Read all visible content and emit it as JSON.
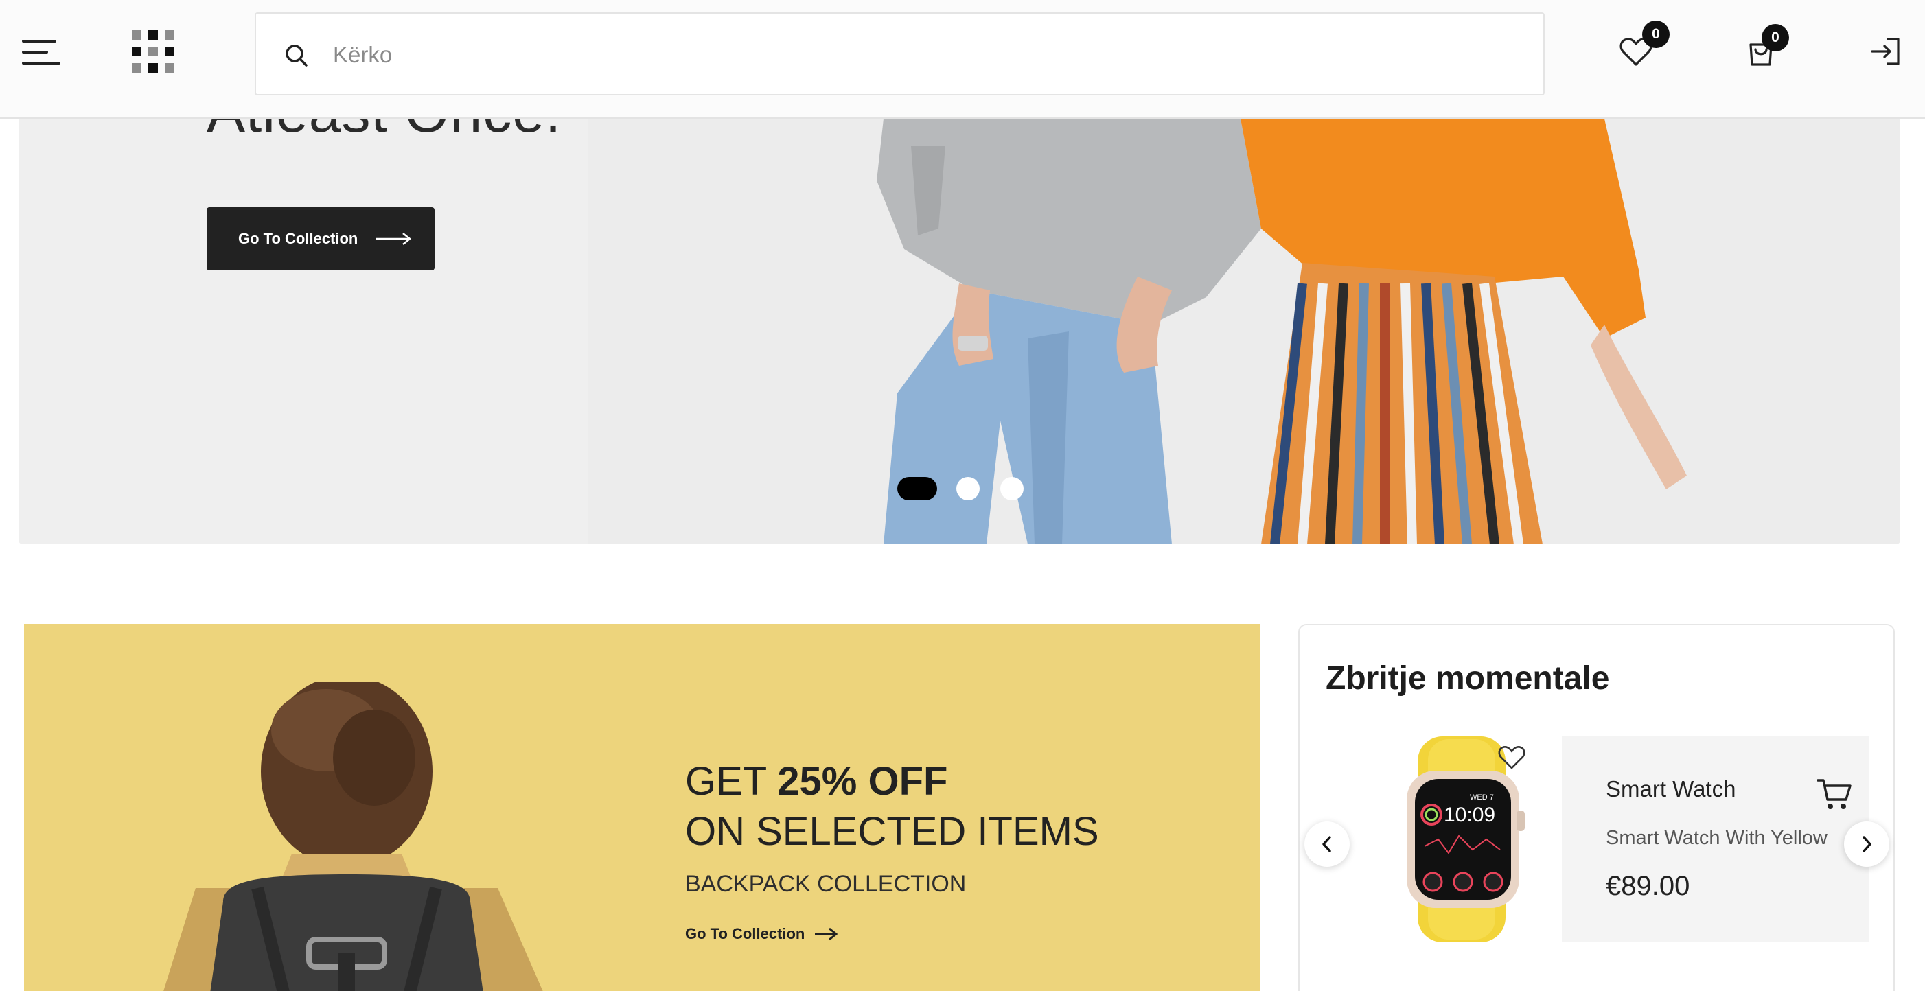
{
  "header": {
    "search": {
      "placeholder": "Kërko",
      "value": ""
    },
    "wishlist": {
      "count": "0"
    },
    "cart": {
      "count": "0"
    },
    "icons": {
      "menu": "hamburger-menu-icon",
      "logo": "grid-logo-icon",
      "search": "search-icon",
      "wishlist": "heart-icon",
      "cart": "shopping-bag-icon",
      "login": "login-icon"
    }
  },
  "hero": {
    "title": "Atleast Once.",
    "button_label": "Go To Collection",
    "slides": {
      "count": 3,
      "active_index": 0
    }
  },
  "promo": {
    "line1_prefix": "GET ",
    "line1_bold": "25% OFF",
    "line2": "ON SELECTED ITEMS",
    "line3": "BACKPACK COLLECTION",
    "link_label": "Go To Collection"
  },
  "deals": {
    "title": "Zbritje momentale",
    "product": {
      "name": "Smart Watch",
      "description": "Smart Watch With Yellow",
      "price": "€89.00",
      "watch_day": "WED 7",
      "watch_time": "10:09"
    }
  },
  "colors": {
    "accent_dark": "#222222",
    "promo_bg": "#edd47c",
    "hero_bg": "#efefef",
    "badge": "#111111"
  }
}
